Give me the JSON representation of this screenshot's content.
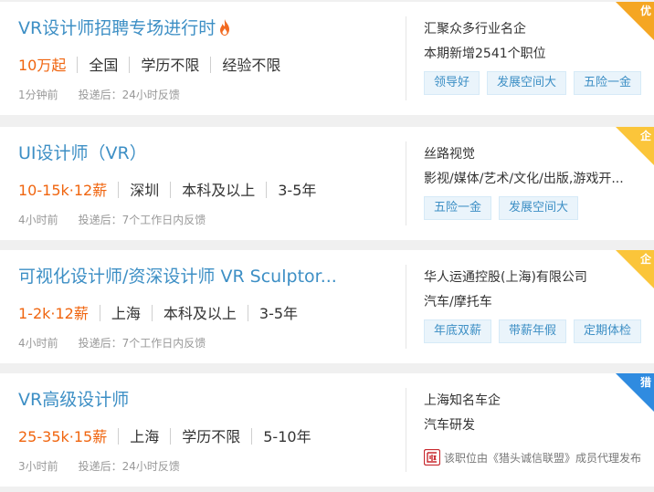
{
  "jobs": [
    {
      "title": "VR设计师招聘专场进行时",
      "salary": "10万起",
      "location": "全国",
      "education": "学历不限",
      "experience": "经验不限",
      "posted": "1分钟前",
      "feedback": "投递后：24小时反馈",
      "company": "汇聚众多行业名企",
      "industry": "本期新增2541个职位",
      "tags": [
        "领导好",
        "发展空间大",
        "五险一金"
      ],
      "badge": "优",
      "badge_color": "#f5a623",
      "hot_icon": "flame-icon"
    },
    {
      "title": "UI设计师（VR）",
      "salary": "10-15k·12薪",
      "location": "深圳",
      "education": "本科及以上",
      "experience": "3-5年",
      "posted": "4小时前",
      "feedback": "投递后：7个工作日内反馈",
      "company": "丝路视觉",
      "industry": "影视/媒体/艺术/文化/出版,游戏开...",
      "tags": [
        "五险一金",
        "发展空间大"
      ],
      "badge": "企",
      "badge_color": "#fbc53a"
    },
    {
      "title": "可视化设计师/资深设计师 VR Sculptor...",
      "salary": "1-2k·12薪",
      "location": "上海",
      "education": "本科及以上",
      "experience": "3-5年",
      "posted": "4小时前",
      "feedback": "投递后：7个工作日内反馈",
      "company": "华人运通控股(上海)有限公司",
      "industry": "汽车/摩托车",
      "tags": [
        "年底双薪",
        "带薪年假",
        "定期体检"
      ],
      "badge": "企",
      "badge_color": "#fbc53a"
    },
    {
      "title": "VR高级设计师",
      "salary": "25-35k·15薪",
      "location": "上海",
      "education": "学历不限",
      "experience": "5-10年",
      "posted": "3小时前",
      "feedback": "投递后：24小时反馈",
      "company": "上海知名车企",
      "industry": "汽车研发",
      "agency_note": "该职位由《猎头诚信联盟》成员代理发布",
      "seal_icon": "seal-icon",
      "badge": "猎",
      "badge_color": "#2f8be0"
    }
  ],
  "colors": {
    "title_blue": "#3d8fc5",
    "salary_orange": "#f0650f",
    "tag_bg": "#eaf4fb"
  }
}
